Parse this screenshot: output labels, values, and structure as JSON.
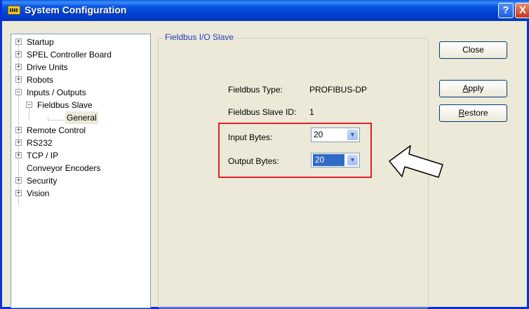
{
  "window": {
    "title": "System Configuration",
    "help_label": "?",
    "close_label": "X"
  },
  "tree": {
    "items": [
      {
        "label": "Startup",
        "expander": "+"
      },
      {
        "label": "SPEL Controller Board",
        "expander": "+"
      },
      {
        "label": "Drive Units",
        "expander": "+"
      },
      {
        "label": "Robots",
        "expander": "+"
      },
      {
        "label": "Inputs / Outputs",
        "expander": "−"
      },
      {
        "label": "Fieldbus Slave",
        "expander": "−"
      },
      {
        "label": "General",
        "selected": true
      },
      {
        "label": "Remote Control",
        "expander": "+"
      },
      {
        "label": "RS232",
        "expander": "+"
      },
      {
        "label": "TCP / IP",
        "expander": "+"
      },
      {
        "label": "Conveyor Encoders"
      },
      {
        "label": "Security",
        "expander": "+"
      },
      {
        "label": "Vision",
        "expander": "+"
      }
    ]
  },
  "group": {
    "title": "Fieldbus I/O Slave",
    "fieldbus_type_label": "Fieldbus Type:",
    "fieldbus_type_value": "PROFIBUS-DP",
    "slave_id_label": "Fieldbus Slave ID:",
    "slave_id_value": "1",
    "input_bytes_label": "Input Bytes:",
    "input_bytes_value": "20",
    "output_bytes_label": "Output Bytes:",
    "output_bytes_value": "20"
  },
  "buttons": {
    "close": "Close",
    "apply_rest": "pply",
    "apply_accel": "A",
    "restore_rest": "estore",
    "restore_accel": "R"
  },
  "colors": {
    "titlebar": "#0054e3",
    "highlight_box": "#e0202a",
    "selection": "#316ac5"
  }
}
